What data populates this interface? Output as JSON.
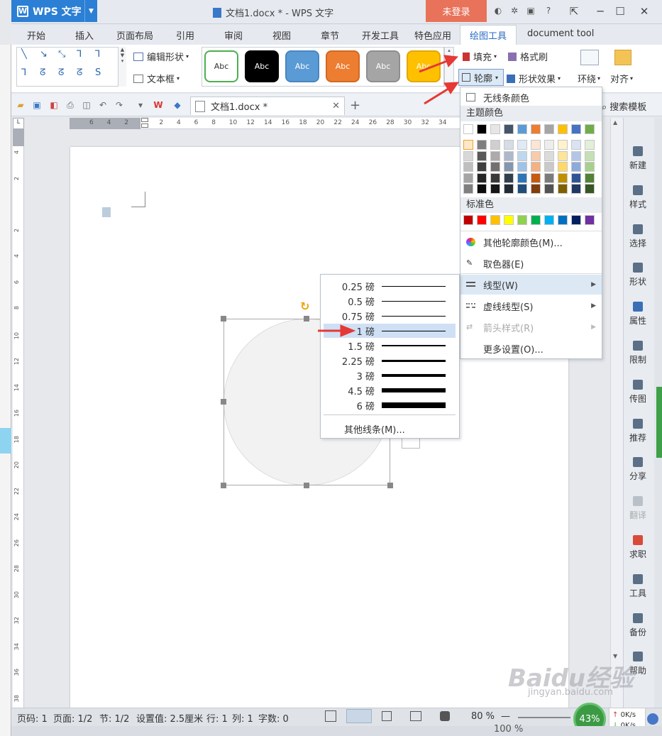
{
  "app": {
    "name": "WPS 文字",
    "title": "文档1.docx * - WPS 文字",
    "login_label": "未登录"
  },
  "menu_tabs": [
    "开始",
    "插入",
    "页面布局",
    "引用",
    "审阅",
    "视图",
    "章节",
    "开发工具",
    "特色应用",
    "绘图工具",
    "document tool"
  ],
  "active_tab": "绘图工具",
  "ribbon": {
    "edit_shape": "编辑形状",
    "text_box": "文本框",
    "style_boxes": [
      {
        "label": "Abc",
        "bg": "#ffffff",
        "fg": "#333333",
        "border": "#4caf50"
      },
      {
        "label": "Abc",
        "bg": "#000000",
        "fg": "#ffffff",
        "border": "#000000"
      },
      {
        "label": "Abc",
        "bg": "#5b9bd5",
        "fg": "#ffffff",
        "border": "#4a86c0"
      },
      {
        "label": "Abc",
        "bg": "#ed7d31",
        "fg": "#ffffff",
        "border": "#d06a22"
      },
      {
        "label": "Abc",
        "bg": "#a5a5a5",
        "fg": "#ffffff",
        "border": "#8e8e8e"
      },
      {
        "label": "Abc",
        "bg": "#ffc000",
        "fg": "#ffffff",
        "border": "#e0a800"
      }
    ],
    "fill": "填充",
    "format_painter": "格式刷",
    "outline": "轮廓",
    "shape_effects": "形状效果",
    "wrap": "环绕",
    "align": "对齐"
  },
  "quick_access": {
    "doc_tab": "文档1.docx *",
    "search_template": "搜索模板"
  },
  "ruler_marks": [
    "6",
    "4",
    "2",
    "",
    "2",
    "4",
    "6",
    "8",
    "10",
    "12",
    "14",
    "16",
    "18",
    "20",
    "22",
    "24",
    "26",
    "28",
    "30",
    "32",
    "34"
  ],
  "vruler_marks": [
    "4",
    "2",
    "",
    "2",
    "4",
    "6",
    "8",
    "10",
    "12",
    "14",
    "16",
    "18",
    "20",
    "22",
    "24",
    "26",
    "28",
    "30",
    "32",
    "34",
    "36",
    "38"
  ],
  "outline_menu": {
    "no_line": "无线条颜色",
    "theme_colors": "主题颜色",
    "standard_colors": "标准色",
    "theme_row1": [
      "#ffffff",
      "#000000",
      "#e7e6e6",
      "#44546a",
      "#5b9bd5",
      "#ed7d31",
      "#a5a5a5",
      "#ffc000",
      "#4472c4",
      "#70ad47"
    ],
    "theme_shades": [
      [
        "#f2f2f2",
        "#7f7f7f",
        "#d0cece",
        "#d6dce4",
        "#deebf6",
        "#fbe5d5",
        "#ededed",
        "#fff2cc",
        "#dae3f3",
        "#e2efd9"
      ],
      [
        "#d8d8d8",
        "#595959",
        "#aeaaaa",
        "#adb9ca",
        "#bdd7ee",
        "#f7cbac",
        "#dbdbdb",
        "#fee599",
        "#b4c6e7",
        "#c5e0b3"
      ],
      [
        "#bfbfbf",
        "#3f3f3f",
        "#757070",
        "#8496b0",
        "#9dc3e6",
        "#f4b183",
        "#c9c9c9",
        "#ffd966",
        "#8eaadb",
        "#a8d08d"
      ],
      [
        "#a5a5a5",
        "#262626",
        "#3a3838",
        "#323f4f",
        "#2e75b5",
        "#c55a11",
        "#7b7b7b",
        "#bf9000",
        "#2f5496",
        "#538135"
      ],
      [
        "#7f7f7f",
        "#0c0c0c",
        "#171616",
        "#222a35",
        "#1e4e79",
        "#833c0b",
        "#525252",
        "#7f6000",
        "#1f3864",
        "#375623"
      ]
    ],
    "standard_row": [
      "#c00000",
      "#ff0000",
      "#ffc000",
      "#ffff00",
      "#92d050",
      "#00b050",
      "#00b0f0",
      "#0070c0",
      "#002060",
      "#7030a0"
    ],
    "more_colors": "其他轮廓颜色(M)...",
    "eyedropper": "取色器(E)",
    "line_type": "线型(W)",
    "dash_type": "虚线线型(S)",
    "arrow_style": "箭头样式(R)",
    "more_settings": "更多设置(O)..."
  },
  "weight_menu": {
    "items": [
      "0.25 磅",
      "0.5 磅",
      "0.75 磅",
      "1 磅",
      "1.5 磅",
      "2.25 磅",
      "3 磅",
      "4.5 磅",
      "6 磅"
    ],
    "line_widths": [
      0.25,
      0.5,
      0.75,
      1,
      1.5,
      2.25,
      3,
      4.5,
      6
    ],
    "selected": "1 磅",
    "more_lines": "其他线条(M)..."
  },
  "right_sidebar": [
    "新建",
    "样式",
    "选择",
    "形状",
    "属性",
    "限制",
    "传图",
    "推荐",
    "分享",
    "翻译",
    "求职",
    "工具",
    "备份",
    "帮助"
  ],
  "status": {
    "page_code": "页码: 1",
    "page": "页面: 1/2",
    "section": "节: 1/2",
    "setting": "设置值: 2.5厘米",
    "row": "行: 1",
    "col": "列: 1",
    "words": "字数: 0",
    "zoom": "80 %",
    "zoom_bottom": "100 %",
    "progress": "43%",
    "net_up": "0K/s",
    "net_down": "0K/s"
  },
  "watermark": {
    "brand": "Baidu经验",
    "url": "jingyan.baidu.com"
  },
  "colors": {
    "accent": "#2b7fd4",
    "login": "#e8735a",
    "arrow": "#e53935",
    "rotate": "#f0a000"
  }
}
